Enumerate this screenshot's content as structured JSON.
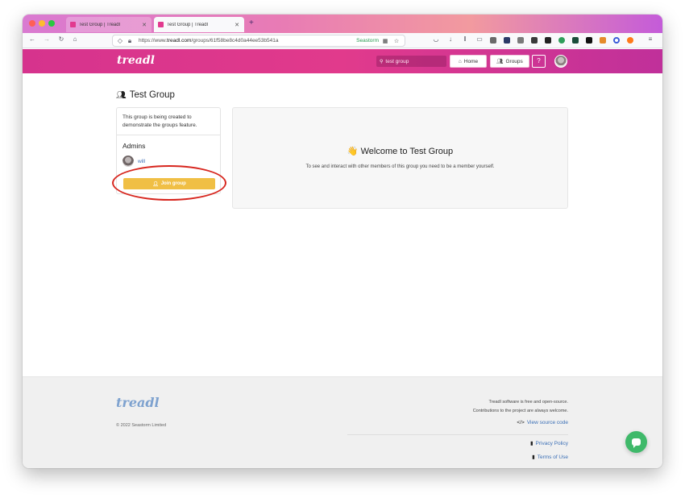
{
  "browser": {
    "tabs": [
      {
        "title": "Test Group | Treadl",
        "active": false
      },
      {
        "title": "Test Group | Treadl",
        "active": true
      }
    ],
    "url": {
      "prefix": "https://www.",
      "host": "treadl.com",
      "path": "/groups/61f58be8c4d0a44ee53b541a"
    },
    "url_badge": "Seastorm"
  },
  "header": {
    "logo": "treadl",
    "search_value": "test group",
    "home_label": "Home",
    "groups_label": "Groups",
    "help_label": "?"
  },
  "group": {
    "title": "Test Group",
    "description": "This group is being created to demonstrate the groups feature.",
    "admins_heading": "Admins",
    "admins": [
      {
        "name": "will"
      }
    ],
    "join_label": "Join group"
  },
  "welcome": {
    "emoji": "👋",
    "heading": "Welcome to Test Group",
    "message": "To see and interact with other members of this group you need to be a member yourself."
  },
  "footer": {
    "logo": "treadl",
    "copyright": "© 2022 Seastorm Limited",
    "line1": "Treadl software is free and open-source.",
    "line2": "Contributions to the project are always welcome.",
    "source_link": "View source code",
    "privacy_link": "Privacy Policy",
    "terms_link": "Terms of Use"
  },
  "colors": {
    "header_gradient_start": "#d6338d",
    "join_button": "#f0bf45",
    "link": "#3b6fb6",
    "chat_button": "#3fb96a",
    "highlight_ring": "#d7261e"
  }
}
